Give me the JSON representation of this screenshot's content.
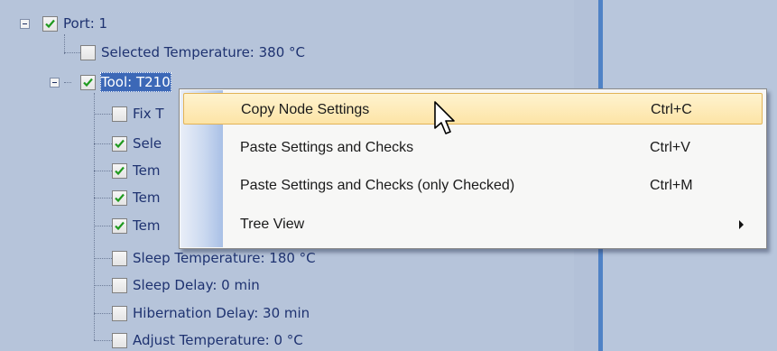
{
  "tree": {
    "nodes": [
      {
        "label": "Port: 1",
        "checked": true
      },
      {
        "label": "Selected Temperature: 380 °C",
        "checked": false
      },
      {
        "label": "Tool: T210",
        "checked": true
      },
      {
        "label": "Fix T",
        "checked": false
      },
      {
        "label": "Sele",
        "checked": true
      },
      {
        "label": "Tem",
        "checked": true
      },
      {
        "label": "Tem",
        "checked": true
      },
      {
        "label": "Tem",
        "checked": true
      },
      {
        "label": "Sleep Temperature: 180 °C",
        "checked": false
      },
      {
        "label": "Sleep Delay: 0 min",
        "checked": false
      },
      {
        "label": "Hibernation Delay: 30 min",
        "checked": false
      },
      {
        "label": "Adjust Temperature: 0 °C",
        "checked": false
      }
    ]
  },
  "context_menu": {
    "items": [
      {
        "label": "Copy Node Settings",
        "shortcut": "Ctrl+C",
        "highlighted": true
      },
      {
        "label": "Paste Settings and Checks",
        "shortcut": "Ctrl+V"
      },
      {
        "label": "Paste Settings and Checks (only Checked)",
        "shortcut": "Ctrl+M"
      },
      {
        "label": "Tree View",
        "shortcut": "",
        "submenu": true
      }
    ]
  },
  "colors": {
    "tree_background": "#b6c4da",
    "splitter_bar": "#4f82c6",
    "selection": "#3c68b7",
    "menu_highlight": "#fde4a6"
  }
}
